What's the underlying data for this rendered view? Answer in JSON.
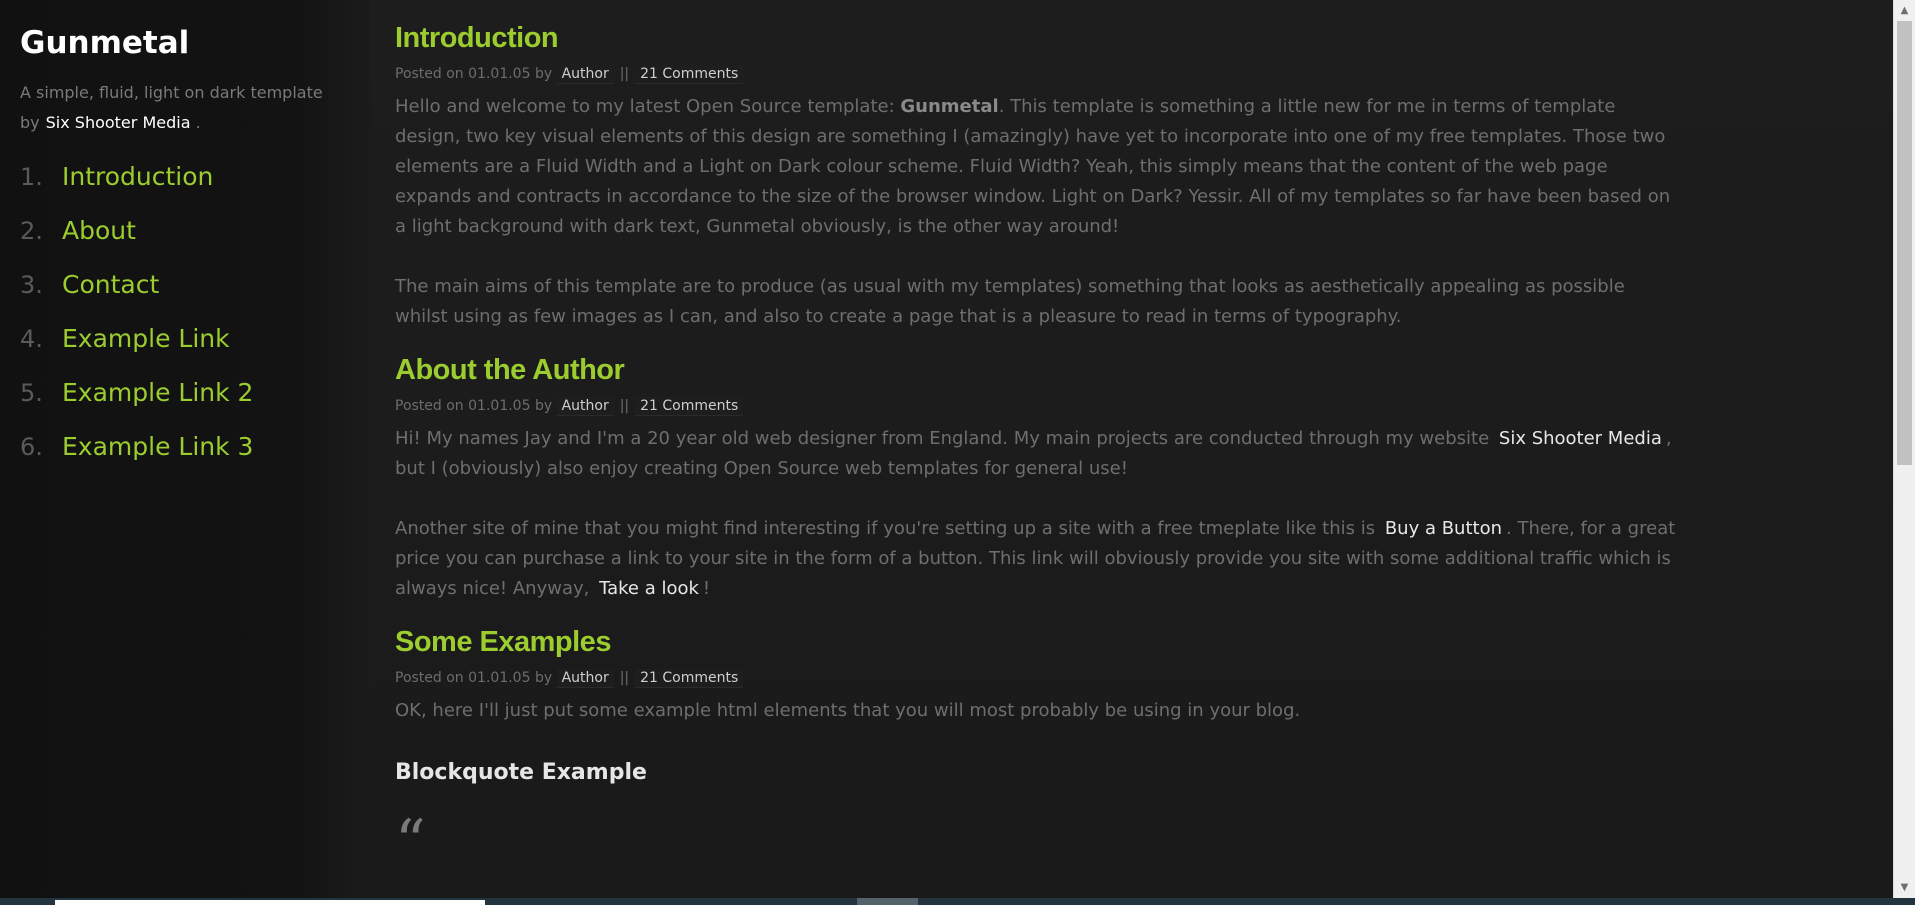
{
  "sidebar": {
    "site_title": "Gunmetal",
    "tagline_text": "A simple, fluid, light on dark template by",
    "tagline_link": "Six Shooter Media",
    "tagline_end": ".",
    "nav": [
      {
        "num": "1.",
        "label": "Introduction"
      },
      {
        "num": "2.",
        "label": "About"
      },
      {
        "num": "3.",
        "label": "Contact"
      },
      {
        "num": "4.",
        "label": "Example Link"
      },
      {
        "num": "5.",
        "label": "Example Link 2"
      },
      {
        "num": "6.",
        "label": "Example Link 3"
      }
    ]
  },
  "posts": [
    {
      "title": "Introduction",
      "meta": {
        "posted_on": "Posted on",
        "date": "01.01.05",
        "by": "by",
        "author": "Author",
        "separator": "||",
        "comments": "21 Comments"
      },
      "p1_a": "Hello and welcome to my latest Open Source template:",
      "p1_strong": "Gunmetal",
      "p1_b": ". This template is something a little new for me in terms of template design, two key visual elements of this design are something I (amazingly) have yet to incorporate into one of my free templates. Those two elements are a Fluid Width and a Light on Dark colour scheme. Fluid Width? Yeah, this simply means that the content of the web page expands and contracts in accordance to the size of the browser window. Light on Dark? Yessir. All of my templates so far have been based on a light background with dark text, Gunmetal obviously, is the other way around!",
      "p2": "The main aims of this template are to produce (as usual with my templates) something that looks as aesthetically appealing as possible whilst using as few images as I can, and also to create a page that is a pleasure to read in terms of typography."
    },
    {
      "title": "About the Author",
      "meta": {
        "posted_on": "Posted on",
        "date": "01.01.05",
        "by": "by",
        "author": "Author",
        "separator": "||",
        "comments": "21 Comments"
      },
      "p1_a": "Hi! My names Jay and I'm a 20 year old web designer from England. My main projects are conducted through my website",
      "p1_link": "Six Shooter Media",
      "p1_b": ", but I (obviously) also enjoy creating Open Source web templates for general use!",
      "p2_a": "Another site of mine that you might find interesting if you're setting up a site with a free tmeplate like this is",
      "p2_link1": "Buy a Button",
      "p2_b": ". There, for a great price you can purchase a link to your site in the form of a button. This link will obviously provide you site with some additional traffic which is always nice! Anyway,",
      "p2_link2": "Take a look",
      "p2_c": "!"
    },
    {
      "title": "Some Examples",
      "meta": {
        "posted_on": "Posted on",
        "date": "01.01.05",
        "by": "by",
        "author": "Author",
        "separator": "||",
        "comments": "21 Comments"
      },
      "p1": "OK, here I'll just put some example html elements that you will most probably be using in your blog.",
      "blockquote_heading": "Blockquote Example",
      "quote_mark": "“"
    }
  ],
  "colors": {
    "accent": "#9ccd2f",
    "background": "#1c1c1c",
    "sidebar": "#121212",
    "body_text": "#6e6e6e",
    "link": "#e8e8e8"
  }
}
